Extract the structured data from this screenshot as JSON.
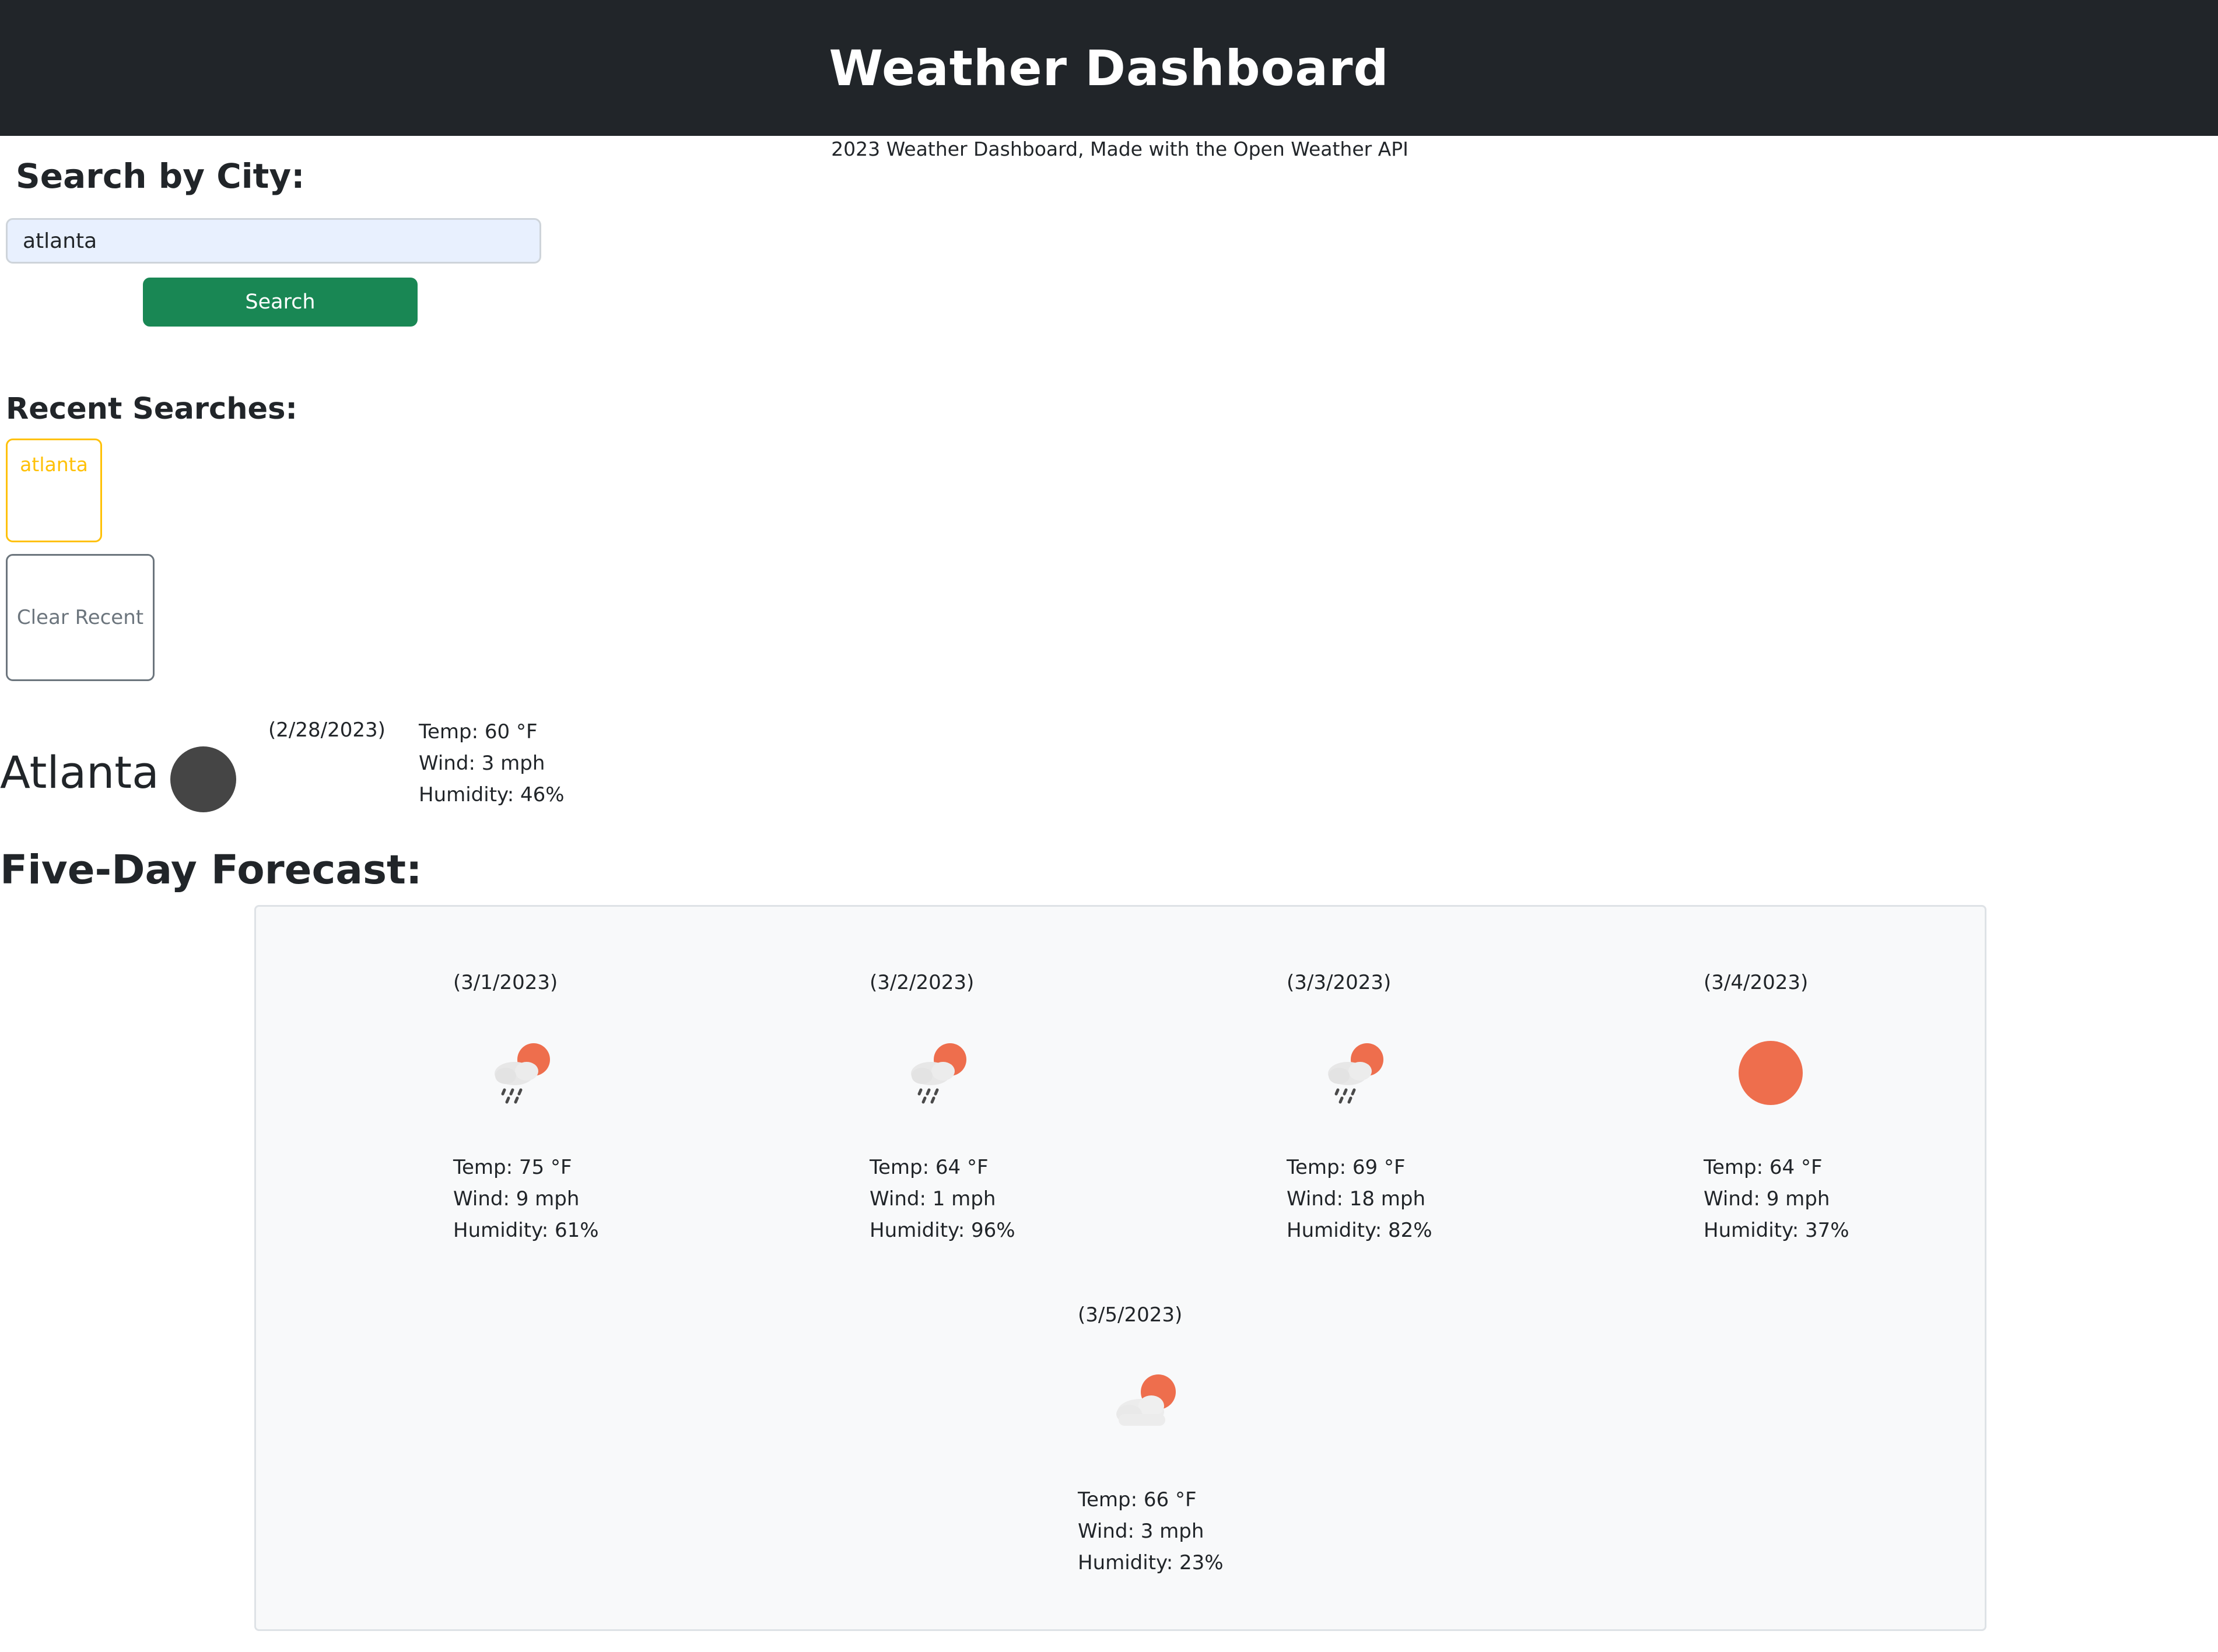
{
  "header": {
    "title": "Weather Dashboard"
  },
  "subtitle": "2023 Weather Dashboard, Made with the Open Weather API",
  "search": {
    "label": "Search by City:",
    "input_value": "atlanta",
    "button_label": "Search"
  },
  "recent": {
    "label": "Recent Searches:",
    "items": [
      {
        "label": "atlanta"
      }
    ],
    "clear_label": "Clear Recent"
  },
  "current": {
    "city": "Atlanta",
    "date": "(2/28/2023)",
    "temp": "Temp: 60 °F",
    "wind": "Wind: 3 mph",
    "humidity": "Humidity: 46%",
    "icon": "dark-circle-icon"
  },
  "forecast": {
    "label": "Five-Day Forecast:",
    "days": [
      {
        "date": "(3/1/2023)",
        "icon": "rain-sun-icon",
        "temp": "Temp: 75 °F",
        "wind": "Wind: 9 mph",
        "humidity": "Humidity: 61%"
      },
      {
        "date": "(3/2/2023)",
        "icon": "rain-sun-icon",
        "temp": "Temp: 64 °F",
        "wind": "Wind: 1 mph",
        "humidity": "Humidity: 96%"
      },
      {
        "date": "(3/3/2023)",
        "icon": "rain-sun-icon",
        "temp": "Temp: 69 °F",
        "wind": "Wind: 18 mph",
        "humidity": "Humidity: 82%"
      },
      {
        "date": "(3/4/2023)",
        "icon": "sun-icon",
        "temp": "Temp: 64 °F",
        "wind": "Wind: 9 mph",
        "humidity": "Humidity: 37%"
      },
      {
        "date": "(3/5/2023)",
        "icon": "cloud-sun-icon",
        "temp": "Temp: 66 °F",
        "wind": "Wind: 3 mph",
        "humidity": "Humidity: 23%"
      }
    ]
  },
  "colors": {
    "header_bg": "#212529",
    "success": "#198754",
    "warning": "#ffc107",
    "secondary": "#6c757d",
    "sun": "#ee6e4d"
  }
}
